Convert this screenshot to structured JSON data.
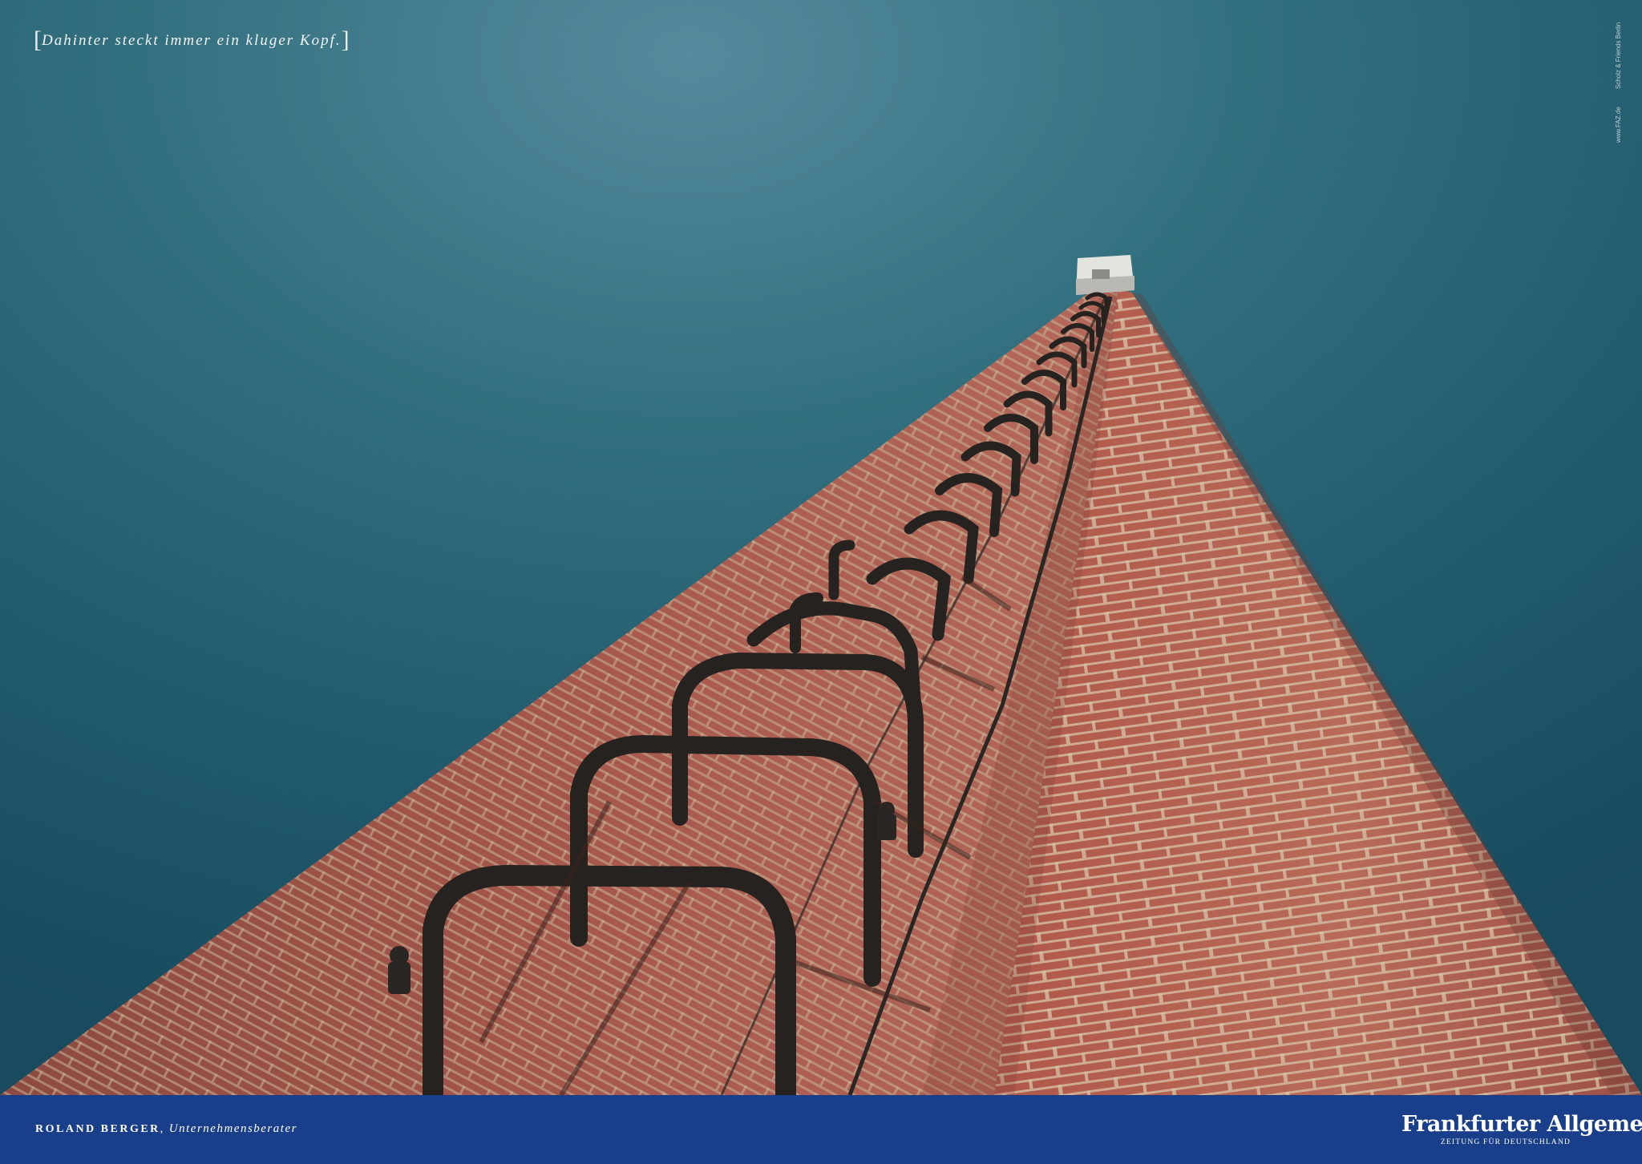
{
  "slogan": {
    "bracket_open": "[",
    "text": "Dahinter steckt immer ein kluger Kopf.",
    "bracket_close": "]"
  },
  "credits": {
    "url": "www.FAZ.de",
    "agency": "Scholz & Friends Berlin"
  },
  "photo": {
    "subject": "brick chimney with climbing ladder",
    "colors": {
      "sky": "#1d5669",
      "brick": "#a6554a",
      "mortar": "#d8c7ad",
      "iron": "#2a2623",
      "cap": "#e6e6e2"
    },
    "ladder_rungs": 20
  },
  "footer": {
    "background": "#193f8a",
    "person": "ROLAND BERGER",
    "separator": ", ",
    "role": "Unternehmensberater"
  },
  "logo": {
    "name": "Frankfurter Allgemeine",
    "tagline": "ZEITUNG FÜR DEUTSCHLAND"
  }
}
